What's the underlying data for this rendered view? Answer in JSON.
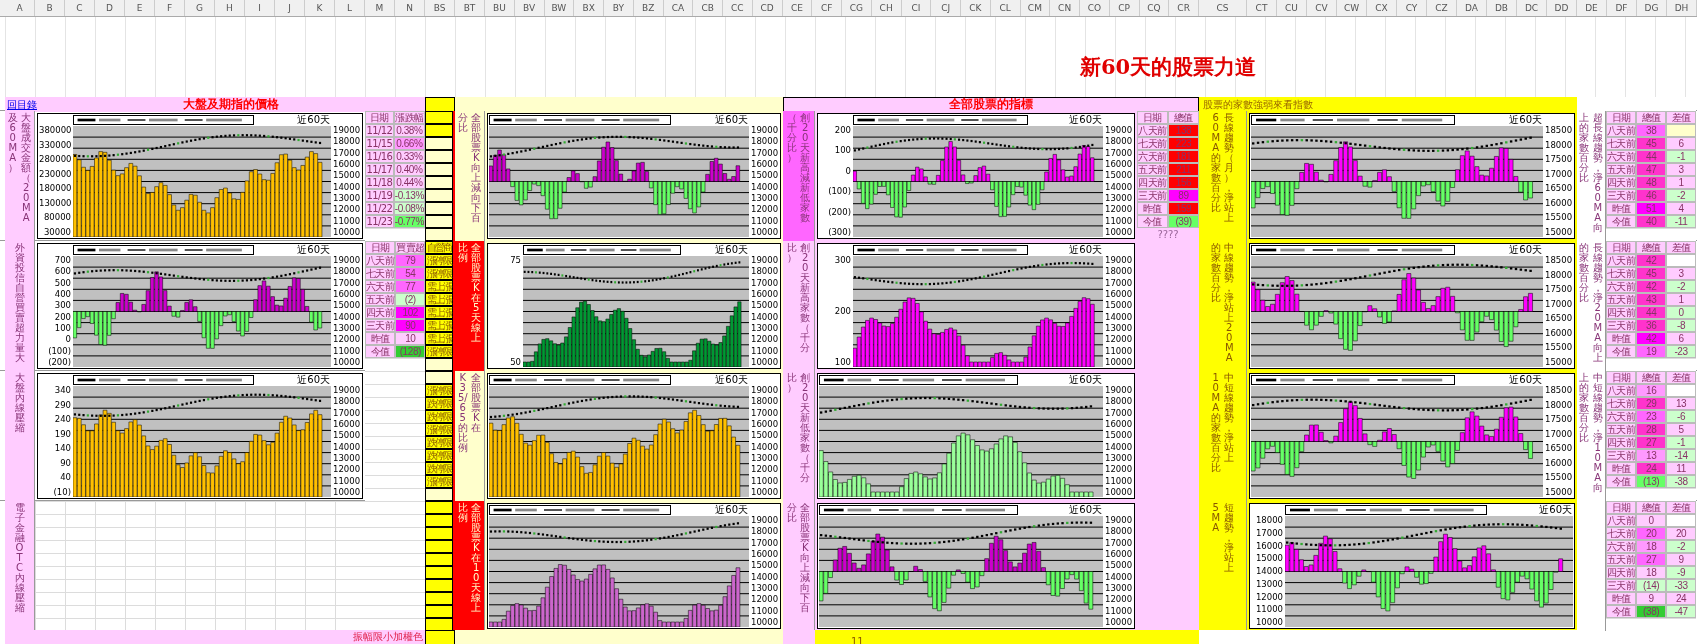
{
  "column_headers": [
    "A",
    "B",
    "C",
    "D",
    "E",
    "F",
    "G",
    "H",
    "I",
    "J",
    "K",
    "L",
    "M",
    "N",
    "BS",
    "BT",
    "BU",
    "BV",
    "BW",
    "BX",
    "BY",
    "BZ",
    "CA",
    "CB",
    "CC",
    "CD",
    "CE",
    "CF",
    "CG",
    "CH",
    "CI",
    "CJ",
    "CK",
    "CL",
    "CM",
    "CN",
    "CO",
    "CP",
    "CQ",
    "CR",
    "CS",
    "CT",
    "CU",
    "CV",
    "CW",
    "CX",
    "CY",
    "CZ",
    "DA",
    "DB",
    "DC",
    "DD",
    "DE",
    "DF",
    "DG",
    "DH"
  ],
  "title": "新60天的股票力道",
  "back_link": "回目錄",
  "headings": {
    "left": "大盤及期指的價格",
    "middle": "全部股票的指標",
    "right": "股票的家數強弱來看指數"
  },
  "rows": [
    {
      "left": {
        "label_cols": [
          "及60MA）",
          "大盤成交金額（20MA"
        ],
        "chart": {
          "kind": "volume",
          "color": "#ffc000",
          "period_label": "近60天",
          "left_ticks": [
            "380000",
            "330000",
            "280000",
            "230000",
            "180000",
            "130000",
            "80000",
            "30000"
          ],
          "right_ticks": [
            "19000",
            "18000",
            "17000",
            "16000",
            "15000",
            "14000",
            "13000",
            "12000",
            "11000",
            "10000"
          ]
        },
        "table": {
          "headers": [
            "日期",
            "漲跌幅"
          ],
          "rows": [
            {
              "cells": [
                {
                  "text": "11/12"
                },
                {
                  "text": "0.38%",
                  "color": "#ffccff"
                }
              ]
            },
            {
              "cells": [
                {
                  "text": "11/15"
                },
                {
                  "text": "0.66%",
                  "color": "#ff99ff"
                }
              ]
            },
            {
              "cells": [
                {
                  "text": "11/16"
                },
                {
                  "text": "0.33%",
                  "color": "#ffccff"
                }
              ]
            },
            {
              "cells": [
                {
                  "text": "11/17"
                },
                {
                  "text": "0.40%",
                  "color": "#ffccff"
                }
              ]
            },
            {
              "cells": [
                {
                  "text": "11/18"
                },
                {
                  "text": "0.44%",
                  "color": "#ffccff"
                }
              ]
            },
            {
              "cells": [
                {
                  "text": "11/19"
                },
                {
                  "text": "-0.13%",
                  "color": "#ccffcc"
                }
              ]
            },
            {
              "cells": [
                {
                  "text": "11/22"
                },
                {
                  "text": "-0.08%",
                  "color": "#ccffcc"
                }
              ]
            },
            {
              "cells": [
                {
                  "text": "11/23"
                },
                {
                  "text": "-0.77%",
                  "color": "#66ff66"
                }
              ]
            }
          ]
        }
      },
      "status_column": [
        {
          "highlight": true
        },
        {
          "highlight": true
        }
      ],
      "middle": {
        "label_cols": [
          "分比",
          "全部股票K向上減向下百"
        ],
        "label_emphasis": false,
        "chart_a": {
          "kind": "diverging",
          "color": "#cc00cc",
          "period_label": "近60天",
          "right_ticks": [
            "19000",
            "18000",
            "17000",
            "16000",
            "15000",
            "14000",
            "13000",
            "12000",
            "11000",
            "10000"
          ]
        },
        "label2_cols": [
          "（千分比）",
          "創20天新高減新低家數"
        ],
        "label2_emphasis": true,
        "chart_b": {
          "kind": "diverging",
          "color": "#ff00ff",
          "period_label": "近60天",
          "left_ticks": [
            "200",
            "100",
            "0",
            "(100)",
            "(200)",
            "(300)"
          ],
          "right_ticks": [
            "19000",
            "18000",
            "17000",
            "16000",
            "15000",
            "14000",
            "13000",
            "12000",
            "11000",
            "10000"
          ]
        },
        "table": {
          "headers": [
            "日期",
            "總值"
          ],
          "note": "????",
          "rows": [
            {
              "cells": [
                {
                  "text": "八天前"
                },
                {
                  "text": "138",
                  "color": "#ff0000"
                }
              ]
            },
            {
              "cells": [
                {
                  "text": "七天前"
                },
                {
                  "text": "223",
                  "color": "#ff0000"
                }
              ]
            },
            {
              "cells": [
                {
                  "text": "六天前"
                },
                {
                  "text": "181",
                  "color": "#ff0000"
                }
              ]
            },
            {
              "cells": [
                {
                  "text": "五天前"
                },
                {
                  "text": "211",
                  "color": "#ff0000"
                }
              ]
            },
            {
              "cells": [
                {
                  "text": "四天前"
                },
                {
                  "text": "156",
                  "color": "#ff0000"
                }
              ]
            },
            {
              "cells": [
                {
                  "text": "三天前"
                },
                {
                  "text": "89",
                  "color": "#ff00ff"
                }
              ]
            },
            {
              "cells": [
                {
                  "text": "昨值"
                },
                {
                  "text": "159",
                  "color": "#ff0000"
                }
              ]
            },
            {
              "cells": [
                {
                  "text": "今值"
                },
                {
                  "text": "(39)",
                  "color": "#66ff66"
                }
              ]
            }
          ]
        }
      },
      "right": {
        "label_cols": [
          "60MA的家數百分比",
          "長線趨勢（月），淨站上"
        ],
        "chart": {
          "kind": "diverging",
          "color": "#ff00ff",
          "period_label": "近60天",
          "right_ticks": [
            "18500",
            "18000",
            "17500",
            "17000",
            "16500",
            "16000",
            "15500",
            "15000"
          ]
        },
        "side_cols": [
          "上的家數百分比",
          "超長線趨勢，淨60MA向"
        ],
        "table": {
          "headers": [
            "日期",
            "總值",
            "差值"
          ],
          "rows": [
            {
              "cells": [
                {
                  "text": "八天前"
                },
                {
                  "text": "38",
                  "color": "#ff66ff"
                },
                {
                  "color": "#ffffcc"
                }
              ]
            },
            {
              "cells": [
                {
                  "text": "七天前"
                },
                {
                  "text": "45",
                  "color": "#ff33cc"
                },
                {
                  "text": "6",
                  "color": "#ffccff"
                }
              ]
            },
            {
              "cells": [
                {
                  "text": "六天前"
                },
                {
                  "text": "44",
                  "color": "#ff33cc"
                },
                {
                  "text": "-1",
                  "color": "#ccffcc"
                }
              ]
            },
            {
              "cells": [
                {
                  "text": "五天前"
                },
                {
                  "text": "47",
                  "color": "#ff33cc"
                },
                {
                  "text": "3",
                  "color": "#ffccff"
                }
              ]
            },
            {
              "cells": [
                {
                  "text": "四天前"
                },
                {
                  "text": "48",
                  "color": "#ff33cc"
                },
                {
                  "text": "1",
                  "color": "#ffccff"
                }
              ]
            },
            {
              "cells": [
                {
                  "text": "三天前"
                },
                {
                  "text": "46",
                  "color": "#ff33cc"
                },
                {
                  "text": "-2",
                  "color": "#ccffcc"
                }
              ]
            },
            {
              "cells": [
                {
                  "text": "昨值"
                },
                {
                  "text": "51",
                  "color": "#ff00ff"
                },
                {
                  "text": "4",
                  "color": "#ffccff"
                }
              ]
            },
            {
              "cells": [
                {
                  "text": "今值"
                },
                {
                  "text": "40",
                  "color": "#ff33cc"
                },
                {
                  "text": "-11",
                  "color": "#ccffcc"
                }
              ]
            }
          ]
        }
      }
    },
    {
      "left": {
        "label_cols": [
          "外資投信自營買賣超力量大"
        ],
        "chart": {
          "kind": "diverging",
          "color": "#cc00cc",
          "period_label": "近60天",
          "left_ticks": [
            "700",
            "600",
            "500",
            "400",
            "300",
            "200",
            "100",
            "0",
            "(100)",
            "(200)"
          ],
          "right_ticks": [
            "19000",
            "18000",
            "17000",
            "16000",
            "15000",
            "14000",
            "13000",
            "12000",
            "11000",
            "10000"
          ]
        },
        "table": {
          "headers": [
            "日期",
            "買賣超"
          ],
          "rows": [
            {
              "cells": [
                {
                  "text": "八天前"
                },
                {
                  "text": "79",
                  "color": "#ff66ff"
                }
              ]
            },
            {
              "cells": [
                {
                  "text": "七天前"
                },
                {
                  "text": "54",
                  "color": "#ff66ff"
                }
              ]
            },
            {
              "cells": [
                {
                  "text": "六天前"
                },
                {
                  "text": "77",
                  "color": "#ff66ff"
                }
              ]
            },
            {
              "cells": [
                {
                  "text": "五天前"
                },
                {
                  "text": "(2)",
                  "color": "#ccffcc"
                }
              ]
            },
            {
              "cells": [
                {
                  "text": "四天前"
                },
                {
                  "text": "102",
                  "color": "#ff00ff"
                }
              ]
            },
            {
              "cells": [
                {
                  "text": "三天前"
                },
                {
                  "text": "90",
                  "color": "#ff00ff"
                }
              ]
            },
            {
              "cells": [
                {
                  "text": "昨值"
                },
                {
                  "text": "10",
                  "color": "#ffccff"
                }
              ]
            },
            {
              "cells": [
                {
                  "text": "今值"
                },
                {
                  "text": "(128)",
                  "color": "#33cc33"
                }
              ]
            }
          ]
        }
      },
      "status_column": [
        {
          "text": "自營商",
          "highlight": true
        },
        {
          "text": "漲停限",
          "highlight": true
        },
        {
          "text": "漲停限",
          "highlight": true
        },
        {
          "text": "需上漲",
          "highlight": true
        },
        {
          "text": "需上漲",
          "highlight": true
        },
        {
          "text": "需上漲",
          "highlight": true
        },
        {
          "text": "需上漲",
          "highlight": true
        },
        {
          "text": "需上漲",
          "highlight": true
        },
        {
          "text": "漲停限",
          "highlight": true
        }
      ],
      "middle": {
        "label_cols": [
          "比例",
          "全部股票K在5天線上"
        ],
        "label_emphasis": true,
        "chart_a": {
          "kind": "histogram",
          "color": "#009933",
          "period_label": "近60天",
          "left_ticks": [
            "75",
            "50"
          ],
          "right_ticks": [
            "19000",
            "18000",
            "17000",
            "16000",
            "15000",
            "14000",
            "13000",
            "12000",
            "11000",
            "10000"
          ]
        },
        "label2_cols": [
          "比）",
          "創20天新高家數（千分"
        ],
        "label2_emphasis": false,
        "chart_b": {
          "kind": "histogram",
          "color": "#ff00ff",
          "period_label": "近60天",
          "left_ticks": [
            "300",
            "200",
            "100"
          ],
          "right_ticks": [
            "19000",
            "18000",
            "17000",
            "16000",
            "15000",
            "14000",
            "13000",
            "12000",
            "11000",
            "10000"
          ]
        }
      },
      "right": {
        "label_cols": [
          "的家數百分比",
          "中線趨勢，淨站上20MA"
        ],
        "chart": {
          "kind": "diverging",
          "color": "#ff00ff",
          "period_label": "近60天",
          "right_ticks": [
            "18500",
            "18000",
            "17500",
            "17000",
            "16500",
            "16000",
            "15500",
            "15000"
          ]
        },
        "side_cols": [
          "的家數百分比",
          "長線趨勢，淨20MA向上"
        ],
        "table": {
          "headers": [
            "日期",
            "總值",
            "差值"
          ],
          "rows": [
            {
              "cells": [
                {
                  "text": "八天前"
                },
                {
                  "text": "42",
                  "color": "#ff33cc"
                },
                {
                  "color": "#ffffff"
                }
              ]
            },
            {
              "cells": [
                {
                  "text": "七天前"
                },
                {
                  "text": "45",
                  "color": "#ff33cc"
                },
                {
                  "text": "3",
                  "color": "#ffccff"
                }
              ]
            },
            {
              "cells": [
                {
                  "text": "六天前"
                },
                {
                  "text": "42",
                  "color": "#ff33cc"
                },
                {
                  "text": "-2",
                  "color": "#ccffcc"
                }
              ]
            },
            {
              "cells": [
                {
                  "text": "五天前"
                },
                {
                  "text": "43",
                  "color": "#ff33cc"
                },
                {
                  "text": "1",
                  "color": "#ffccff"
                }
              ]
            },
            {
              "cells": [
                {
                  "text": "四天前"
                },
                {
                  "text": "44",
                  "color": "#ff33cc"
                },
                {
                  "text": "0",
                  "color": "#ccffcc"
                }
              ]
            },
            {
              "cells": [
                {
                  "text": "三天前"
                },
                {
                  "text": "36",
                  "color": "#ff33cc"
                },
                {
                  "text": "-8",
                  "color": "#ccffcc"
                }
              ]
            },
            {
              "cells": [
                {
                  "text": "昨值"
                },
                {
                  "text": "42",
                  "color": "#ff00ff"
                },
                {
                  "text": "6",
                  "color": "#ffccff"
                }
              ]
            },
            {
              "cells": [
                {
                  "text": "今值"
                },
                {
                  "text": "19",
                  "color": "#ff66ff"
                },
                {
                  "text": "-23",
                  "color": "#ccffcc"
                }
              ]
            }
          ]
        }
      }
    },
    {
      "left": {
        "label_cols": [
          "大盤內線壓縮"
        ],
        "chart": {
          "kind": "volume",
          "color": "#ffc000",
          "period_label": "近60天",
          "left_ticks": [
            "340",
            "290",
            "240",
            "190",
            "140",
            "90",
            "40",
            "(10)"
          ],
          "right_ticks": [
            "19000",
            "18000",
            "17000",
            "16000",
            "15000",
            "14000",
            "13000",
            "12000",
            "11000",
            "10000"
          ]
        }
      },
      "status_column": [
        {
          "highlight": false
        },
        {
          "text": "漲停限",
          "highlight": true
        },
        {
          "text": "跌停限",
          "highlight": true
        },
        {
          "text": "跌停限",
          "highlight": true
        },
        {
          "text": "漲停限",
          "highlight": true
        },
        {
          "text": "跌停限",
          "highlight": true
        },
        {
          "text": "跌停限",
          "highlight": true
        },
        {
          "text": "跌停限",
          "highlight": true
        },
        {
          "text": "漲停限",
          "highlight": true
        }
      ],
      "middle": {
        "label_cols": [
          "K35/65的比例",
          "全部股票K在"
        ],
        "label_emphasis": false,
        "chart_a": {
          "kind": "volume",
          "color": "#ffc000",
          "period_label": "近60天",
          "right_ticks": [
            "19000",
            "18000",
            "17000",
            "16000",
            "15000",
            "14000",
            "13000",
            "12000",
            "11000",
            "10000"
          ]
        },
        "label2_cols": [
          "比）",
          "創20天新低家數（千分"
        ],
        "label2_emphasis": false,
        "chart_b": {
          "kind": "histogram",
          "color": "#99ff99",
          "period_label": "近60天",
          "right_ticks": [
            "19000",
            "18000",
            "17000",
            "16000",
            "15000",
            "14000",
            "13000",
            "12000",
            "11000",
            "10000"
          ]
        }
      },
      "right": {
        "label_cols": [
          "10MA的家數百分比",
          "中短線趨勢，淨站上"
        ],
        "chart": {
          "kind": "diverging",
          "color": "#ff00ff",
          "period_label": "近60天",
          "right_ticks": [
            "18500",
            "18000",
            "17500",
            "17000",
            "16500",
            "16000",
            "15500",
            "15000"
          ]
        },
        "side_cols": [
          "上的家數百分比",
          "中短線趨勢，淨10MA向"
        ],
        "table": {
          "headers": [
            "日期",
            "總值",
            "差值"
          ],
          "rows": [
            {
              "cells": [
                {
                  "text": "八天前"
                },
                {
                  "text": "16",
                  "color": "#ff99ff"
                },
                {
                  "color": "#ffffff"
                }
              ]
            },
            {
              "cells": [
                {
                  "text": "七天前"
                },
                {
                  "text": "29",
                  "color": "#ff33cc"
                },
                {
                  "text": "13",
                  "color": "#ffccff"
                }
              ]
            },
            {
              "cells": [
                {
                  "text": "六天前"
                },
                {
                  "text": "23",
                  "color": "#ff66ff"
                },
                {
                  "text": "-6",
                  "color": "#ccffcc"
                }
              ]
            },
            {
              "cells": [
                {
                  "text": "五天前"
                },
                {
                  "text": "28",
                  "color": "#ff33cc"
                },
                {
                  "text": "5",
                  "color": "#ffccff"
                }
              ]
            },
            {
              "cells": [
                {
                  "text": "四天前"
                },
                {
                  "text": "27",
                  "color": "#ff33cc"
                },
                {
                  "text": "-1",
                  "color": "#ccffcc"
                }
              ]
            },
            {
              "cells": [
                {
                  "text": "三天前"
                },
                {
                  "text": "13",
                  "color": "#ff99ff"
                },
                {
                  "text": "-14",
                  "color": "#ccffcc"
                }
              ]
            },
            {
              "cells": [
                {
                  "text": "昨值"
                },
                {
                  "text": "24",
                  "color": "#ff33cc"
                },
                {
                  "text": "11",
                  "color": "#ffccff"
                }
              ]
            },
            {
              "cells": [
                {
                  "text": "今值"
                },
                {
                  "text": "(13)",
                  "color": "#66ff66"
                },
                {
                  "text": "-38",
                  "color": "#ccffcc"
                }
              ]
            }
          ]
        }
      }
    },
    {
      "left": {
        "label_cols": [
          "電子金融OTC內線壓縮"
        ]
      },
      "status_column": [
        {
          "highlight": true
        },
        {
          "highlight": true
        },
        {
          "highlight": true
        },
        {
          "highlight": true
        },
        {
          "highlight": true
        },
        {
          "highlight": true
        },
        {
          "highlight": true
        },
        {
          "highlight": true
        },
        {
          "highlight": true
        },
        {
          "highlight": true
        }
      ],
      "middle": {
        "label_cols": [
          "比例",
          "全部股票K在10天線上"
        ],
        "label_emphasis": true,
        "chart_a": {
          "kind": "histogram",
          "color": "#cc66cc",
          "period_label": "近60天",
          "right_ticks": [
            "19000",
            "18000",
            "17000",
            "16000",
            "15000",
            "14000",
            "13000",
            "12000",
            "11000",
            "10000"
          ]
        },
        "label2_cols": [
          "分比",
          "全部股票K向上減向下百"
        ],
        "label2_emphasis": false,
        "chart_b": {
          "kind": "diverging",
          "color": "#cc00cc",
          "period_label": "近60天",
          "right_ticks": [
            "19000",
            "18000",
            "17000",
            "16000",
            "15000",
            "14000",
            "13000",
            "12000",
            "11000",
            "10000"
          ]
        }
      },
      "right": {
        "label_cols": [
          "5MA",
          "短趨勢，淨站上"
        ],
        "chart": {
          "kind": "diverging",
          "color": "#ff00ff",
          "period_label": "近60天",
          "left_ticks": [
            "18000",
            "17000",
            "16000",
            "15000",
            "14000",
            "13000",
            "12000",
            "11000",
            "10000"
          ]
        },
        "table": {
          "headers": [
            "日期",
            "總值",
            "差值"
          ],
          "rows": [
            {
              "cells": [
                {
                  "text": "八天前"
                },
                {
                  "text": "0",
                  "color": "#ffccff"
                },
                {
                  "color": "#ffffff"
                }
              ]
            },
            {
              "cells": [
                {
                  "text": "七天前"
                },
                {
                  "text": "20",
                  "color": "#ff66ff"
                },
                {
                  "text": "20",
                  "color": "#ffccff"
                }
              ]
            },
            {
              "cells": [
                {
                  "text": "六天前"
                },
                {
                  "text": "18",
                  "color": "#ff99ff"
                },
                {
                  "text": "-2",
                  "color": "#ccffcc"
                }
              ]
            },
            {
              "cells": [
                {
                  "text": "五天前"
                },
                {
                  "text": "27",
                  "color": "#ff66ff"
                },
                {
                  "text": "9",
                  "color": "#ffccff"
                }
              ]
            },
            {
              "cells": [
                {
                  "text": "四天前"
                },
                {
                  "text": "18",
                  "color": "#ffccff"
                },
                {
                  "text": "-9",
                  "color": "#ccffcc"
                }
              ]
            },
            {
              "cells": [
                {
                  "text": "三天前"
                },
                {
                  "text": "(14)",
                  "color": "#ccffcc"
                },
                {
                  "text": "-33",
                  "color": "#ccffcc"
                }
              ]
            },
            {
              "cells": [
                {
                  "text": "昨值"
                },
                {
                  "text": "9",
                  "color": "#ffccff"
                },
                {
                  "text": "24",
                  "color": "#ffccff"
                }
              ]
            },
            {
              "cells": [
                {
                  "text": "今值"
                },
                {
                  "text": "(38)",
                  "color": "#33cc33"
                },
                {
                  "text": "-47",
                  "color": "#ccffcc"
                }
              ]
            }
          ]
        }
      }
    }
  ],
  "footer": {
    "left_note": "振幅限小加權色",
    "page_number": "11"
  }
}
